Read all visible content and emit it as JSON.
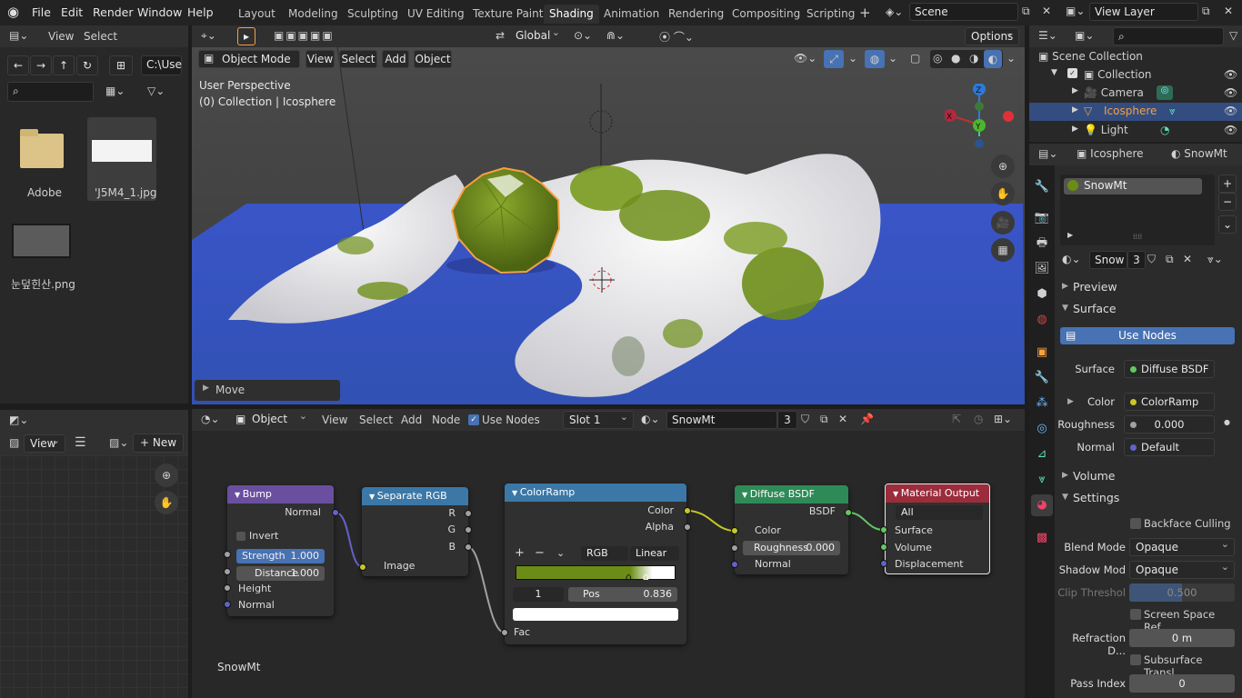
{
  "menubar": {
    "items": [
      "File",
      "Edit",
      "Render",
      "Window",
      "Help"
    ]
  },
  "workspaces": [
    "Layout",
    "Modeling",
    "Sculpting",
    "UV Editing",
    "Texture Paint",
    "Shading",
    "Animation",
    "Rendering",
    "Compositing",
    "Scripting"
  ],
  "active_workspace": "Shading",
  "scene": {
    "name": "Scene",
    "view_layer": "View Layer"
  },
  "filebrowser": {
    "menu": [
      "View",
      "Select"
    ],
    "path": "C:\\Use",
    "files": [
      {
        "name": "Adobe",
        "type": "folder"
      },
      {
        "name": "'J5M4_1.jpg",
        "type": "image"
      },
      {
        "name": "눈덮힌산.png",
        "type": "image"
      }
    ]
  },
  "viewport": {
    "mode": "Object Mode",
    "menu": [
      "View",
      "Select",
      "Add",
      "Object"
    ],
    "transform": "Global",
    "options": "Options",
    "info_line1": "User Perspective",
    "info_line2": "(0) Collection | Icosphere",
    "operator": "Move",
    "gizmo": {
      "x": "X",
      "y": "Y",
      "z": "Z"
    }
  },
  "outliner": {
    "root": "Scene Collection",
    "collection": "Collection",
    "items": [
      "Camera",
      "Icosphere",
      "Light"
    ],
    "selected": "Icosphere"
  },
  "properties": {
    "object": "Icosphere",
    "material": "SnowMt",
    "slot": "SnowMt",
    "mat_field": "Snow",
    "users": "3",
    "preview": "Preview",
    "surface": "Surface",
    "use_nodes": "Use Nodes",
    "rows": [
      {
        "label": "Surface",
        "value": "Diffuse BSDF",
        "color": "#63c763"
      },
      {
        "label": "Color",
        "value": "ColorRamp",
        "color": "#c7c729"
      },
      {
        "label": "Roughness",
        "value": "0.000",
        "color": "#a1a1a1"
      },
      {
        "label": "Normal",
        "value": "Default",
        "color": "#6363c7"
      }
    ],
    "volume": "Volume",
    "settings": "Settings",
    "backface": "Backface Culling",
    "blend_mode_label": "Blend Mode",
    "blend_mode": "Opaque",
    "shadow_label": "Shadow Mod",
    "shadow": "Opaque",
    "clip_label": "Clip Threshol",
    "clip": "0.500",
    "ssr": "Screen Space Ref...",
    "refraction_label": "Refraction D...",
    "refraction": "0 m",
    "sss": "Subsurface Transl...",
    "pass_label": "Pass Index",
    "pass": "0"
  },
  "image_editor": {
    "view": "View",
    "new": "New"
  },
  "node_editor": {
    "object": "Object",
    "menu": [
      "View",
      "Select",
      "Add",
      "Node"
    ],
    "use_nodes": "Use Nodes",
    "slot": "Slot 1",
    "material": "SnowMt",
    "users": "3",
    "label": "SnowMt",
    "bump": {
      "title": "Bump",
      "normal": "Normal",
      "invert": "Invert",
      "strength_label": "Strength",
      "strength": "1.000",
      "distance_label": "Distance",
      "distance": "1.000",
      "height": "Height",
      "normal_in": "Normal"
    },
    "sep": {
      "title": "Separate RGB",
      "r": "R",
      "g": "G",
      "b": "B",
      "image": "Image"
    },
    "ramp": {
      "title": "ColorRamp",
      "color": "Color",
      "alpha": "Alpha",
      "mode": "RGB",
      "interp": "Linear",
      "index": "1",
      "pos_label": "Pos",
      "pos": "0.836",
      "fac": "Fac",
      "plus": "+",
      "minus": "−"
    },
    "diffuse": {
      "title": "Diffuse BSDF",
      "bsdf": "BSDF",
      "color": "Color",
      "rough_label": "Roughness",
      "rough": "0.000",
      "normal": "Normal"
    },
    "output": {
      "title": "Material Output",
      "target": "All",
      "surface": "Surface",
      "volume": "Volume",
      "displacement": "Displacement"
    }
  },
  "colors": {
    "accent": "#4772b3",
    "bump": "#6a4fa0",
    "sep": "#3b78a8",
    "ramp": "#3b78a8",
    "diffuse": "#2e8b57",
    "output": "#9b2c3b",
    "orange": "#f5a142"
  }
}
